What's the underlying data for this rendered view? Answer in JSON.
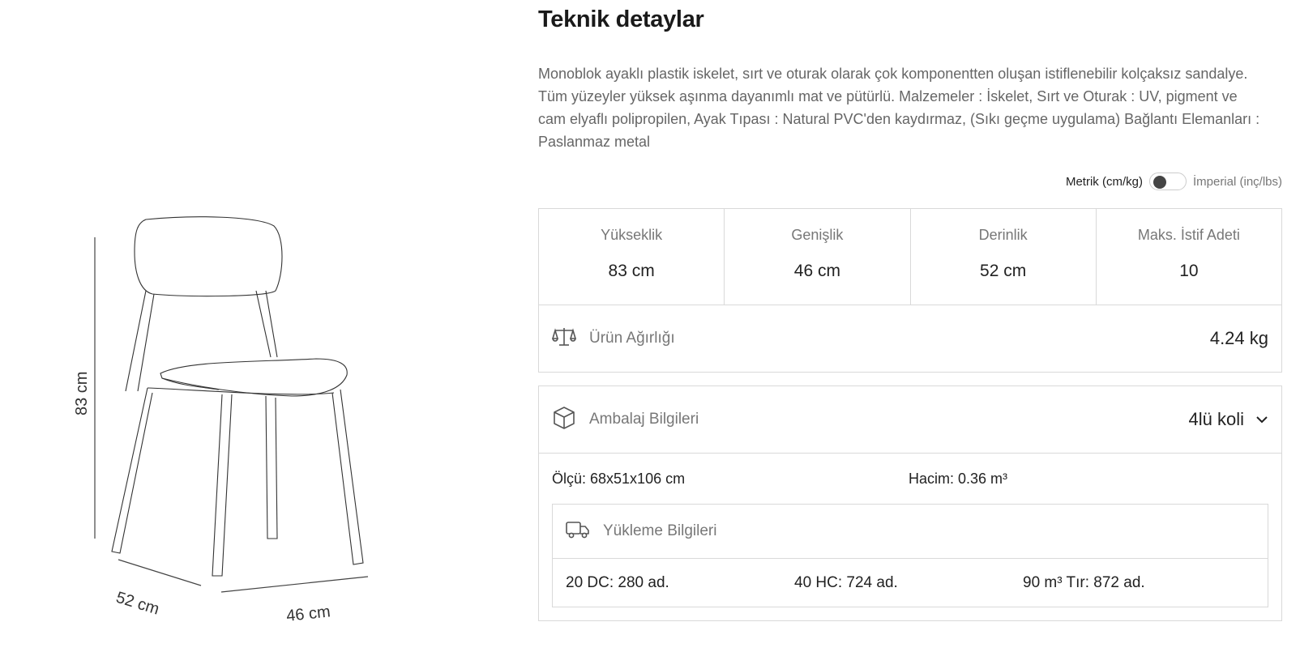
{
  "title": "Teknik detaylar",
  "description": "Monoblok ayaklı plastik iskelet, sırt ve oturak olarak çok komponentten oluşan istiflenebilir kolçaksız sandalye. Tüm yüzeyler yüksek aşınma dayanımlı mat ve pütürlü. Malzemeler : İskelet, Sırt ve Oturak : UV, pigment ve cam elyaflı polipropilen, Ayak Tıpası : Natural PVC'den kaydırmaz, (Sıkı geçme uygulama) Bağlantı Elemanları : Paslanmaz metal",
  "drawing": {
    "height_label": "83 cm",
    "depth_label": "52 cm",
    "width_label": "46 cm"
  },
  "unit_toggle": {
    "metric_label": "Metrik (cm/kg)",
    "imperial_label": "İmperial (inç/lbs)",
    "selected": "metric"
  },
  "dimensions": [
    {
      "label": "Yükseklik",
      "value": "83 cm"
    },
    {
      "label": "Genişlik",
      "value": "46 cm"
    },
    {
      "label": "Derinlik",
      "value": "52 cm"
    },
    {
      "label": "Maks. İstif Adeti",
      "value": "10"
    }
  ],
  "weight": {
    "label": "Ürün Ağırlığı",
    "value": "4.24 kg",
    "icon": "scale-icon"
  },
  "packaging": {
    "label": "Ambalaj Bilgileri",
    "value": "4lü koli",
    "icon": "box-icon",
    "size": "Ölçü: 68x51x106 cm",
    "volume": "Hacim: 0.36 m³"
  },
  "loading": {
    "label": "Yükleme Bilgileri",
    "icon": "truck-icon",
    "items": [
      "20 DC: 280 ad.",
      "40 HC: 724 ad.",
      "90 m³ Tır: 872 ad."
    ]
  }
}
